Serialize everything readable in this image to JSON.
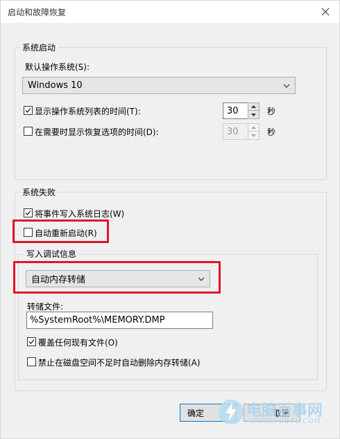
{
  "dialog": {
    "title": "启动和故障恢复"
  },
  "system_startup": {
    "legend": "系统启动",
    "default_os_label": "默认操作系统(S):",
    "default_os_value": "Windows 10",
    "show_os_list": {
      "label": "显示操作系统列表的时间(T):",
      "checked": true,
      "value": "30",
      "unit": "秒"
    },
    "show_recovery": {
      "label": "在需要时显示恢复选项的时间(D):",
      "checked": false,
      "value": "30",
      "unit": "秒"
    }
  },
  "system_failure": {
    "legend": "系统失败",
    "write_event_log": {
      "label": "将事件写入系统日志(W)",
      "checked": true
    },
    "auto_restart": {
      "label": "自动重新启动(R)",
      "checked": false
    },
    "debug_info": {
      "legend": "写入调试信息",
      "type_value": "自动内存转储",
      "dump_file_label": "转储文件:",
      "dump_file_value": "%SystemRoot%\\MEMORY.DMP",
      "overwrite": {
        "label": "覆盖任何现有文件(O)",
        "checked": true
      },
      "disable_low_disk": {
        "label": "禁止在磁盘空间不足时自动删除内存转储(A)",
        "checked": false
      }
    }
  },
  "buttons": {
    "ok": "确定",
    "cancel": "取消"
  },
  "watermark": {
    "text": "电脑百事网",
    "url": "WWW.PC841.COM"
  },
  "colors": {
    "highlight": "#e0152a",
    "dialog_bg": "#f0f0f0"
  }
}
